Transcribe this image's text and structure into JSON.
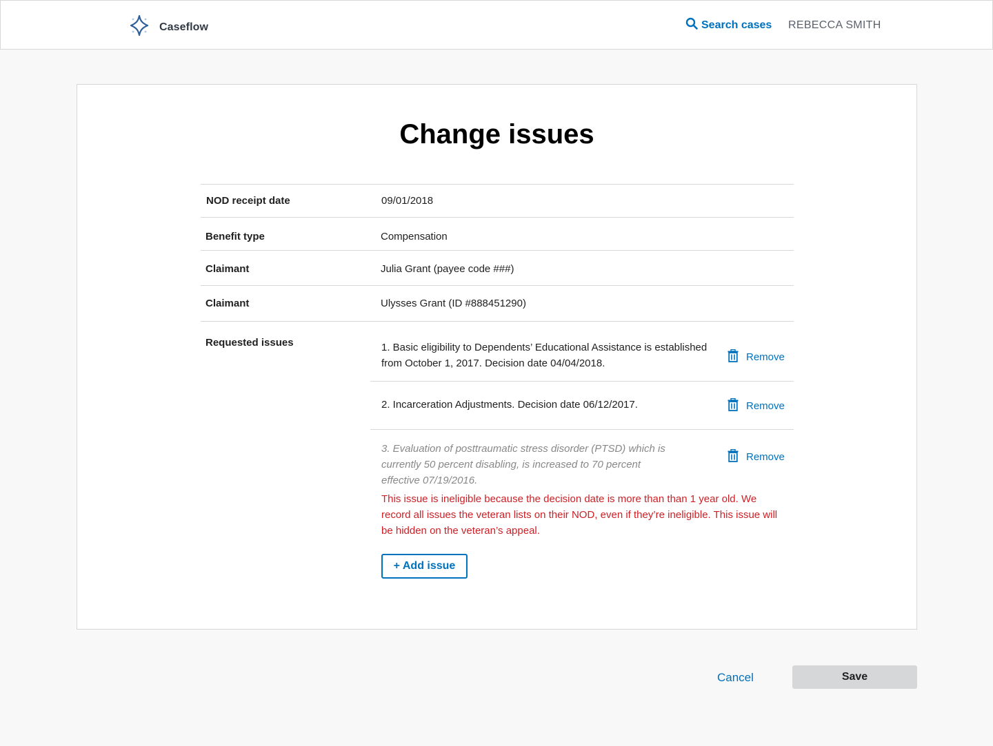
{
  "header": {
    "brand_name": "Caseflow",
    "search_label": "Search cases",
    "user_name": "REBECCA SMITH"
  },
  "page": {
    "title": "Change issues"
  },
  "details": [
    {
      "label": "NOD receipt date",
      "value": "09/01/2018"
    },
    {
      "label": "Benefit type",
      "value": "Compensation"
    },
    {
      "label": "Claimant",
      "value": "Julia Grant (payee code ###)"
    },
    {
      "label": "Claimant",
      "value": "Ulysses Grant (ID #888451290)"
    }
  ],
  "requested_issues": {
    "label": "Requested issues",
    "remove_label": "Remove",
    "items": [
      {
        "text": "1. Basic eligibility to Dependents’ Educational Assistance is established from October 1, 2017. Decision date 04/04/2018.",
        "ineligible": false
      },
      {
        "text": "2. Incarceration Adjustments. Decision date 06/12/2017.",
        "ineligible": false
      },
      {
        "text": "3. Evaluation of posttraumatic stress disorder (PTSD) which is currently 50 percent disabling, is increased to 70 percent effective 07/19/2016.",
        "ineligible": true,
        "error": "This issue is ineligible because the decision date is more than than 1 year old. We record all issues the veteran lists on their NOD, even if they’re ineligible. This issue will be hidden on the veteran’s appeal."
      }
    ],
    "add_label": "+ Add issue"
  },
  "footer": {
    "cancel_label": "Cancel",
    "save_label": "Save"
  },
  "colors": {
    "link": "#0071bc",
    "error": "#cd2026",
    "border": "#d6d7d9",
    "background": "#f8f8f8"
  }
}
